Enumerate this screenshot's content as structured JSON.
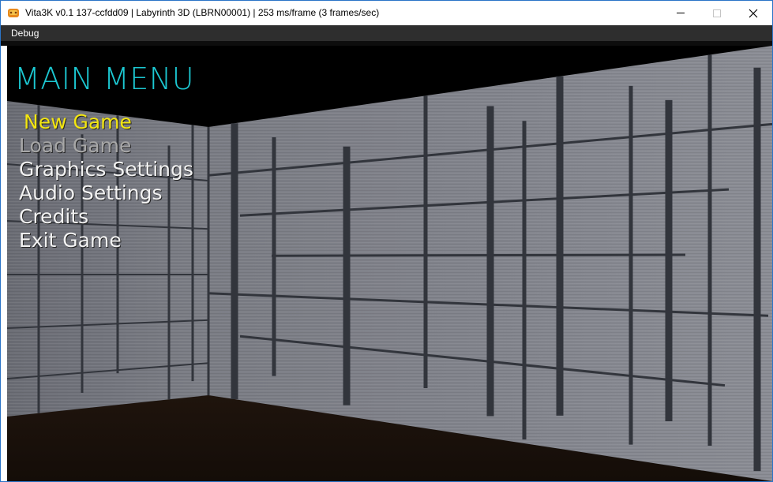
{
  "window": {
    "title": "Vita3K v0.1 137-ccfdd09 | Labyrinth 3D (LBRN00001) | 253 ms/frame (3 frames/sec)",
    "app_icon": "vita3k-logo-icon",
    "controls": {
      "minimize": "—",
      "maximize": "☐",
      "close": "✕"
    }
  },
  "menubar": {
    "items": [
      "Debug"
    ]
  },
  "game": {
    "menu_title": "MAIN MENU",
    "options": [
      {
        "label": "New Game",
        "state": "selected"
      },
      {
        "label": "Load Game",
        "state": "disabled"
      },
      {
        "label": "Graphics Settings",
        "state": "normal"
      },
      {
        "label": "Audio Settings",
        "state": "normal"
      },
      {
        "label": "Credits",
        "state": "normal"
      },
      {
        "label": "Exit Game",
        "state": "normal"
      }
    ],
    "colors": {
      "title": "#1cc8d2",
      "selected": "#f3e612",
      "disabled": "#a7a7a7",
      "normal": "#f2f2f2",
      "wall": "#75777f",
      "floor": "#1a110c",
      "sky": "#000000"
    }
  }
}
